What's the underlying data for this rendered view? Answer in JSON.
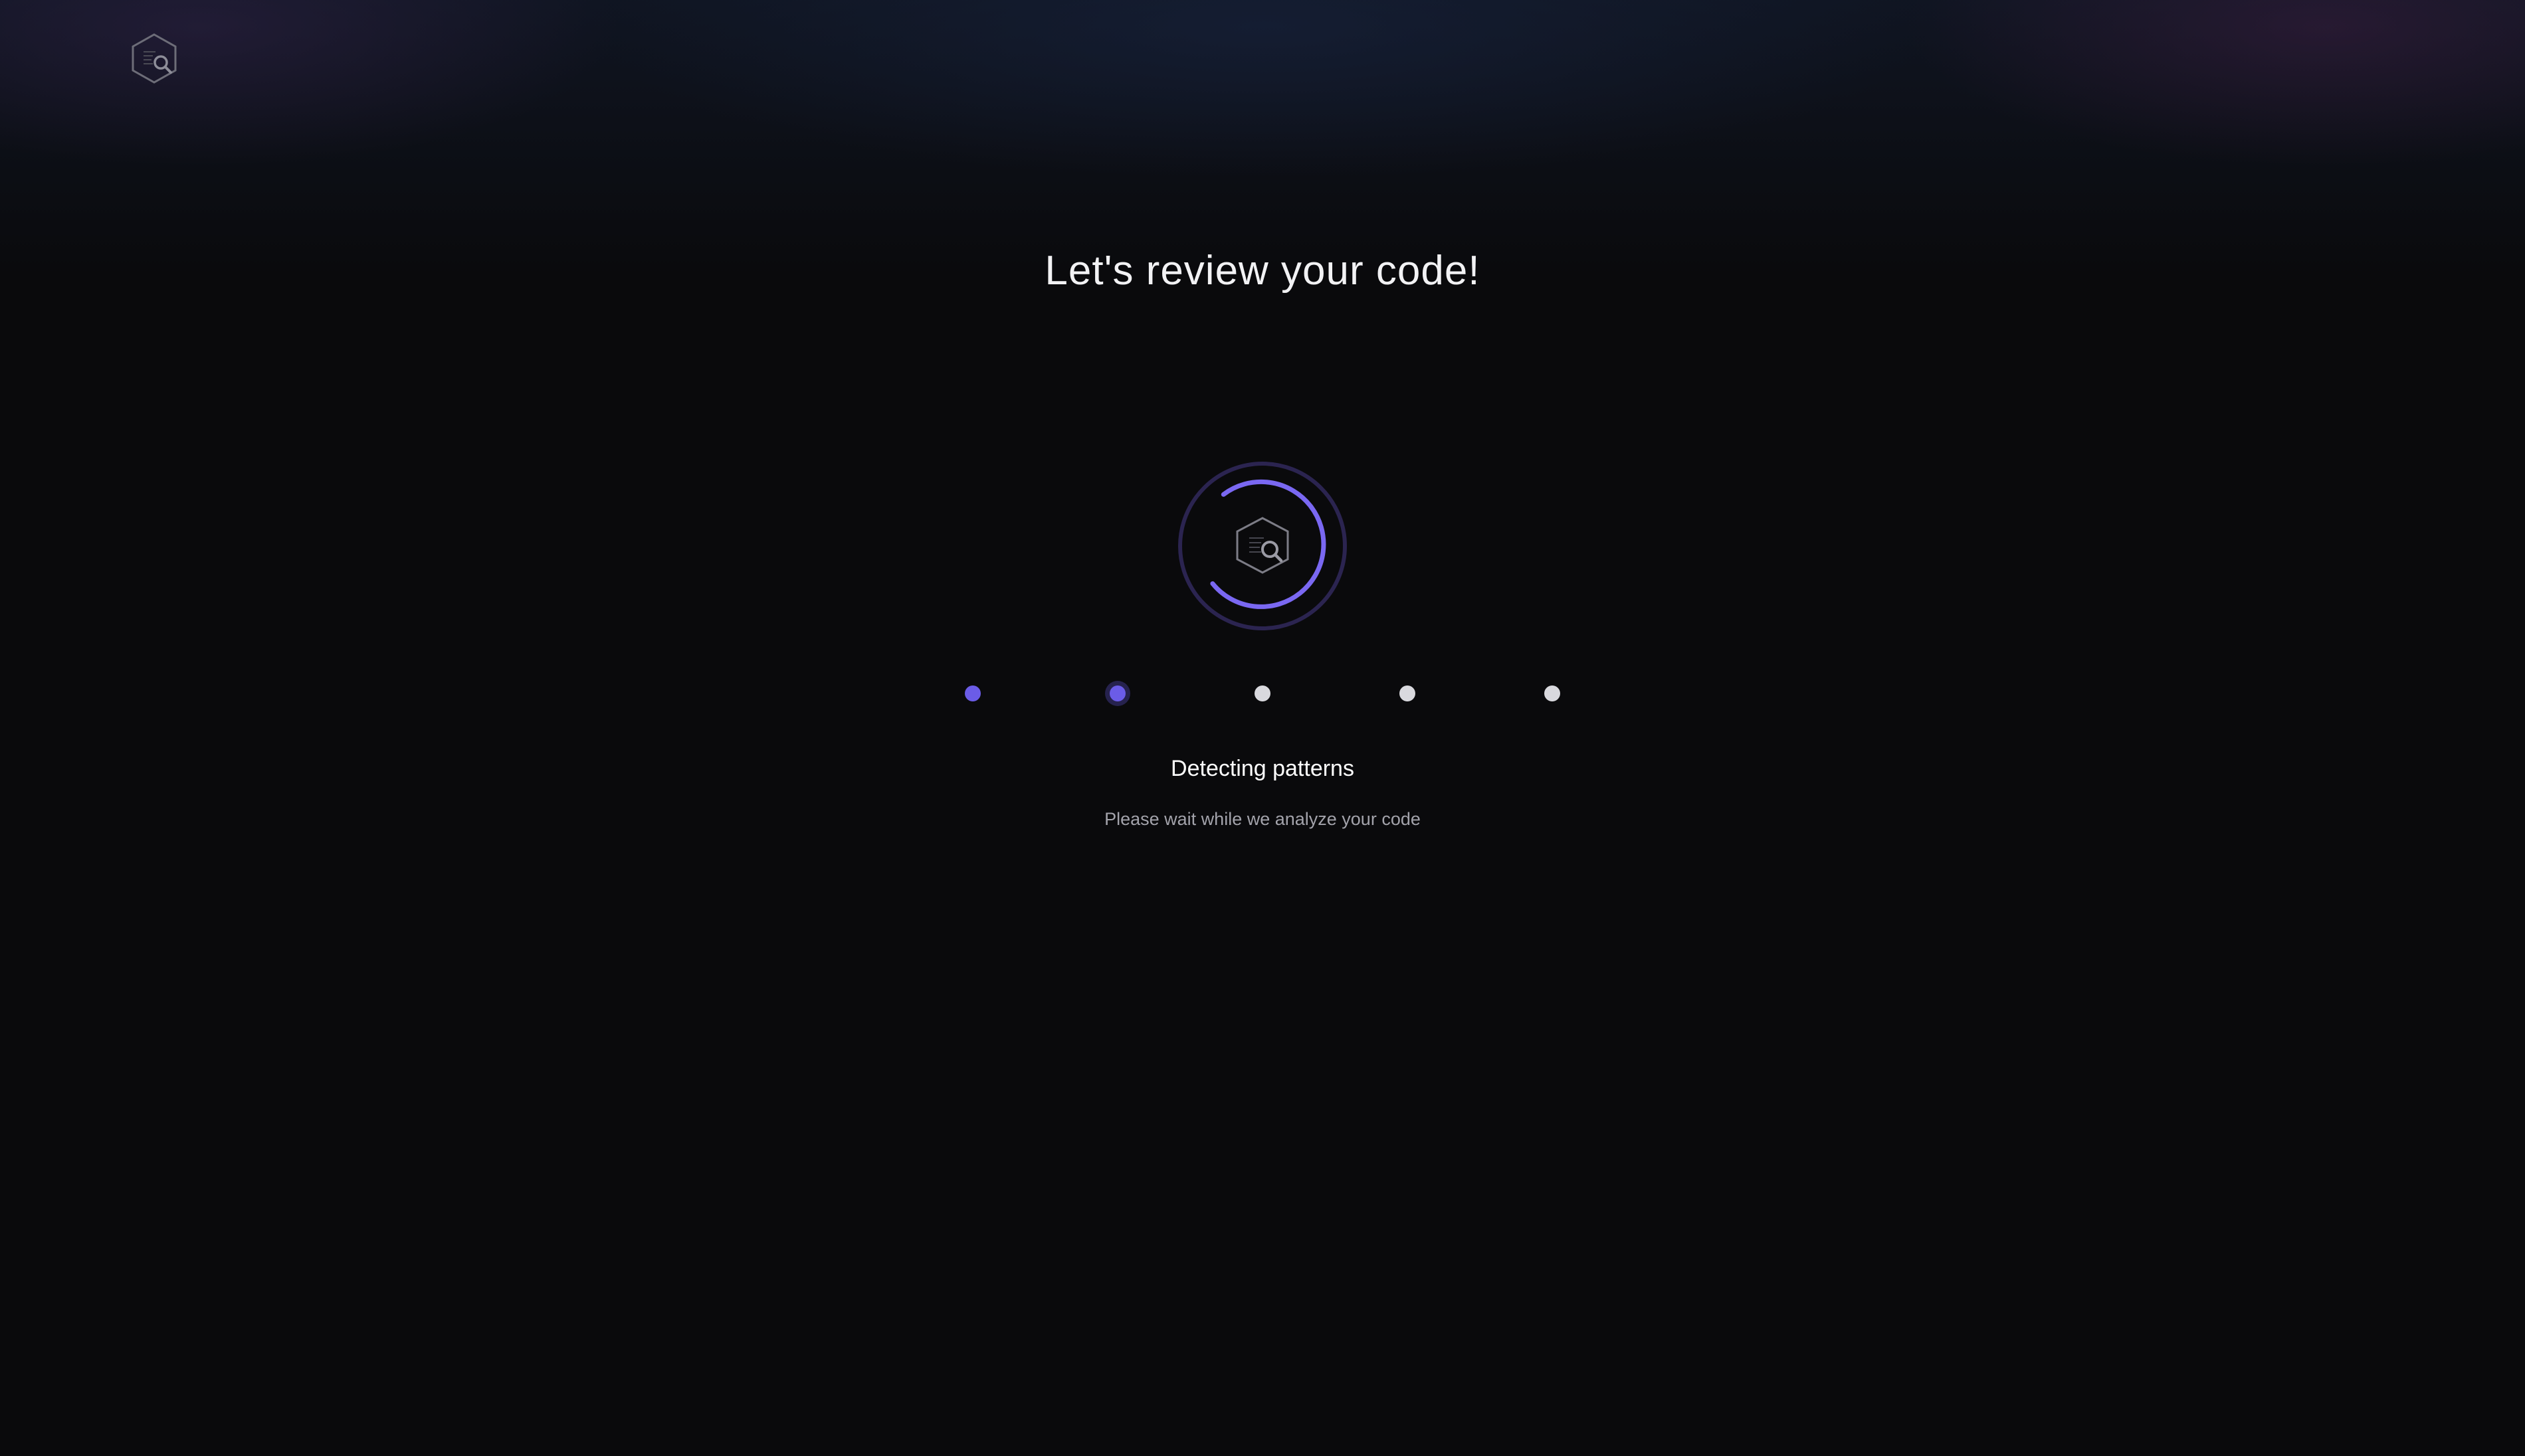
{
  "app": {
    "logo_icon": "code-review-hexagon-search-icon"
  },
  "header": {
    "title": "Let's review your code!"
  },
  "loader": {
    "icon": "code-review-hexagon-search-icon",
    "accent_color": "#6b5ce7",
    "ring_color": "#2b2450"
  },
  "steps": [
    {
      "state": "done"
    },
    {
      "state": "active"
    },
    {
      "state": "pending"
    },
    {
      "state": "pending"
    },
    {
      "state": "pending"
    }
  ],
  "status": {
    "title": "Detecting patterns",
    "subtitle": "Please wait while we analyze your code"
  },
  "colors": {
    "background": "#0a0a0c",
    "accent": "#6b5ce7",
    "pending_dot": "#d9d9de",
    "text_primary": "#ffffff",
    "text_secondary": "#a3a3ab"
  }
}
